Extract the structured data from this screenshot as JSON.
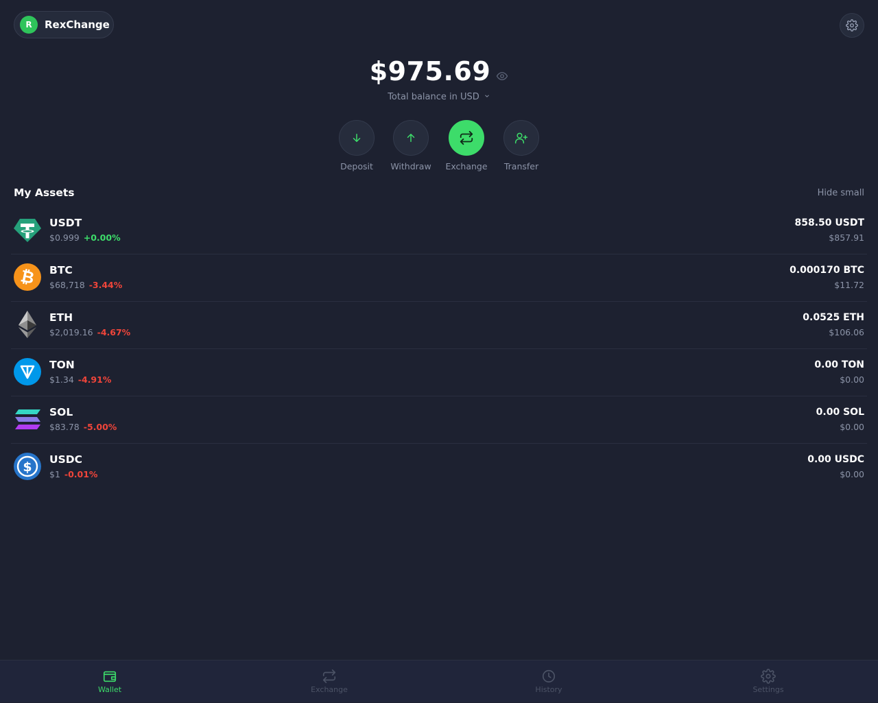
{
  "app": {
    "name": "RexChange",
    "avatar_letter": "R"
  },
  "balance": {
    "amount": "$975.69",
    "label": "Total balance in USD"
  },
  "actions": [
    {
      "label": "Deposit",
      "icon": "arrow-down-icon"
    },
    {
      "label": "Withdraw",
      "icon": "arrow-up-icon"
    },
    {
      "label": "Exchange",
      "icon": "exchange-icon"
    },
    {
      "label": "Transfer",
      "icon": "user-plus-icon"
    }
  ],
  "assets": {
    "title": "My Assets",
    "hide_small": "Hide small",
    "items": [
      {
        "symbol": "USDT",
        "price": "$0.999",
        "change": "+0.00%",
        "amount": "858.50 USDT",
        "value": "$857.91",
        "icon": "usdt-icon"
      },
      {
        "symbol": "BTC",
        "price": "$68,718",
        "change": "-3.44%",
        "amount": "0.000170 BTC",
        "value": "$11.72",
        "icon": "btc-icon"
      },
      {
        "symbol": "ETH",
        "price": "$2,019.16",
        "change": "-4.67%",
        "amount": "0.0525 ETH",
        "value": "$106.06",
        "icon": "eth-icon"
      },
      {
        "symbol": "TON",
        "price": "$1.34",
        "change": "-4.91%",
        "amount": "0.00 TON",
        "value": "$0.00",
        "icon": "ton-icon"
      },
      {
        "symbol": "SOL",
        "price": "$83.78",
        "change": "-5.00%",
        "amount": "0.00 SOL",
        "value": "$0.00",
        "icon": "sol-icon"
      },
      {
        "symbol": "USDC",
        "price": "$1",
        "change": "-0.01%",
        "amount": "0.00 USDC",
        "value": "$0.00",
        "icon": "usdc-icon"
      }
    ]
  },
  "nav": [
    {
      "label": "Wallet",
      "icon": "wallet-icon",
      "active": true
    },
    {
      "label": "Exchange",
      "icon": "exchange-icon",
      "active": false
    },
    {
      "label": "History",
      "icon": "clock-icon",
      "active": false
    },
    {
      "label": "Settings",
      "icon": "gear-icon",
      "active": false
    }
  ],
  "colors": {
    "background": "#1d2130",
    "accent": "#3ddc6a",
    "negative": "#f0453a",
    "muted": "#8c94a8"
  }
}
